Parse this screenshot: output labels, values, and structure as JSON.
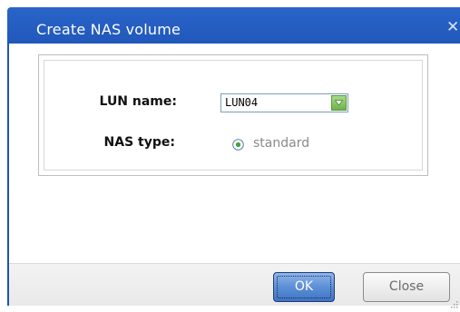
{
  "dialog": {
    "title": "Create NAS volume",
    "close_icon": "close-icon"
  },
  "form": {
    "lun_label": "LUN name:",
    "lun_value": "LUN04",
    "nas_type_label": "NAS type:",
    "nas_type_option": "standard",
    "nas_type_selected": true
  },
  "footer": {
    "ok_label": "OK",
    "close_label": "Close"
  },
  "colors": {
    "title_bar": "#1f55b8",
    "ok_button": "#5c8fd6",
    "dropdown_button": "#6fb24a",
    "radio_dot": "#3aa33a"
  }
}
